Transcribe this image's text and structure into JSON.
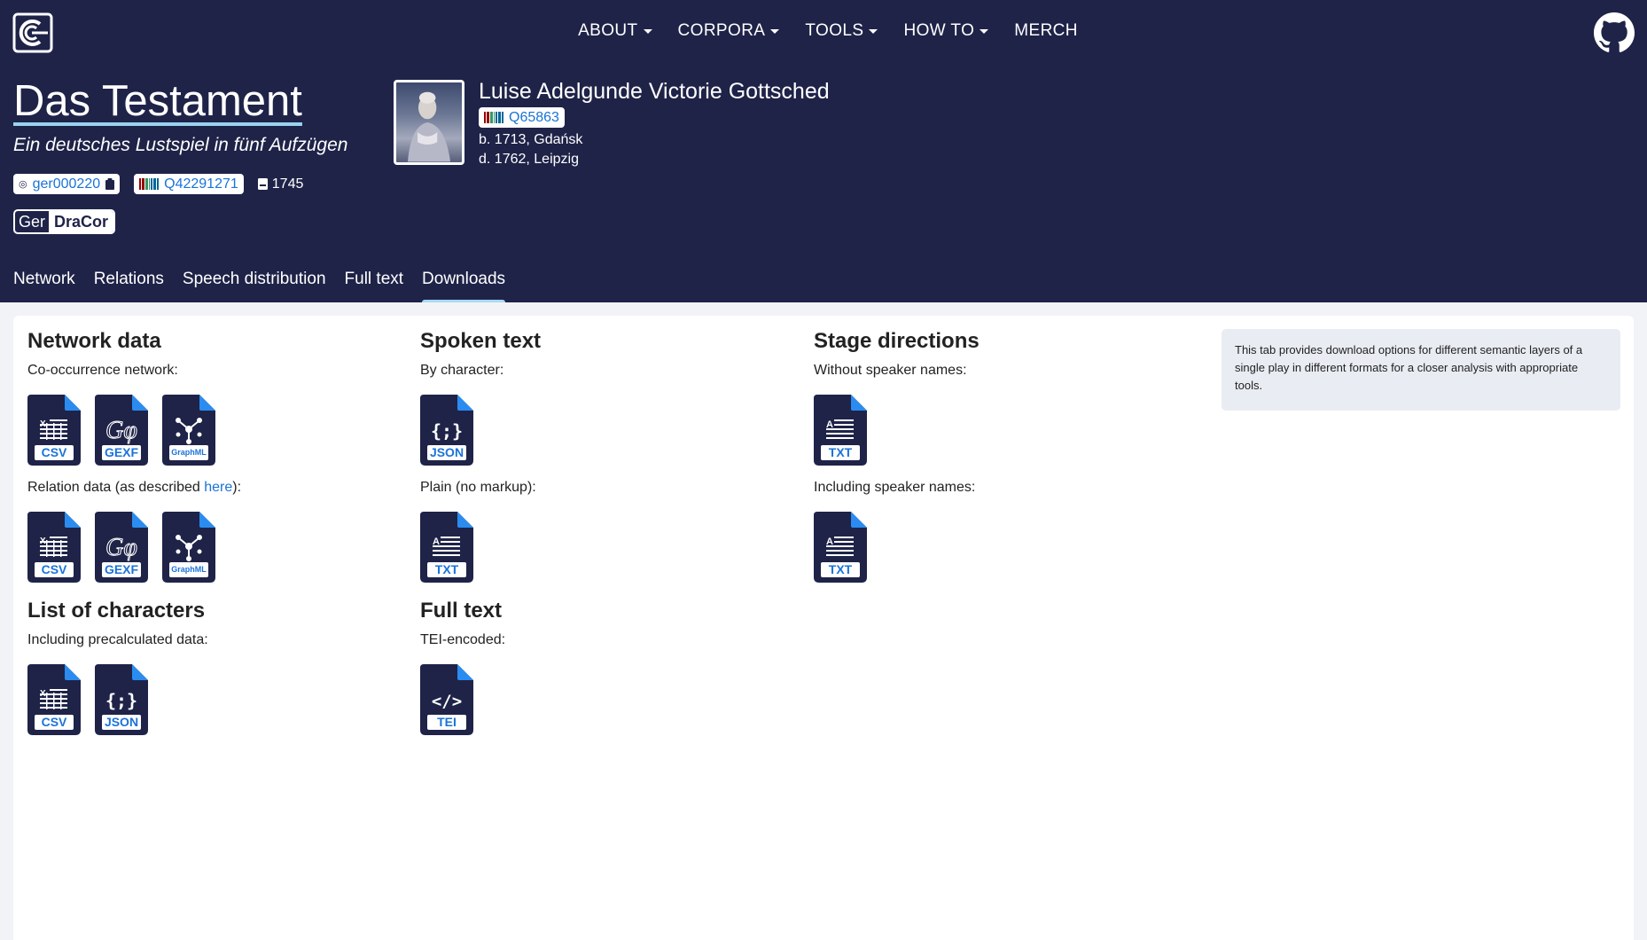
{
  "nav": {
    "items": [
      {
        "label": "ABOUT",
        "dropdown": true
      },
      {
        "label": "CORPORA",
        "dropdown": true
      },
      {
        "label": "TOOLS",
        "dropdown": true
      },
      {
        "label": "HOW TO",
        "dropdown": true
      },
      {
        "label": "MERCH",
        "dropdown": false
      }
    ]
  },
  "play": {
    "title": "Das Testament",
    "subtitle": "Ein deutsches Lustspiel in fünf Aufzügen",
    "dracor_id": "ger000220",
    "wikidata_id": "Q42291271",
    "year": "1745",
    "corpus_prefix": "Ger",
    "corpus_name": "DraCor"
  },
  "author": {
    "name": "Luise Adelgunde Victorie Gottsched",
    "wikidata_id": "Q65863",
    "born": "b. 1713, Gdańsk",
    "died": "d. 1762, Leipzig"
  },
  "tabs": [
    {
      "label": "Network",
      "active": false
    },
    {
      "label": "Relations",
      "active": false
    },
    {
      "label": "Speech distribution",
      "active": false
    },
    {
      "label": "Full text",
      "active": false
    },
    {
      "label": "Downloads",
      "active": true
    }
  ],
  "downloads": {
    "network": {
      "title": "Network data",
      "cooccurrence_label": "Co-occurrence network:",
      "relation_label_prefix": "Relation data (as described ",
      "relation_link": "here",
      "relation_label_suffix": "):",
      "formats": [
        "CSV",
        "GEXF",
        "GraphML"
      ]
    },
    "characters": {
      "title": "List of characters",
      "label": "Including precalculated data:",
      "formats": [
        "CSV",
        "JSON"
      ]
    },
    "spoken": {
      "title": "Spoken text",
      "by_character_label": "By character:",
      "by_character_format": "JSON",
      "plain_label": "Plain (no markup):",
      "plain_format": "TXT"
    },
    "fulltext": {
      "title": "Full text",
      "label": "TEI-encoded:",
      "format": "TEI"
    },
    "stage": {
      "title": "Stage directions",
      "without_label": "Without speaker names:",
      "without_format": "TXT",
      "with_label": "Including speaker names:",
      "with_format": "TXT"
    },
    "info": "This tab provides download options for different semantic layers of a single play in different formats for a closer analysis with appropriate tools."
  },
  "colors": {
    "header_bg": "#1f2348",
    "link": "#1a73d9",
    "file_icon": "#1f2348",
    "file_corner": "#2a8cf0",
    "tab_indicator": "#a8daf2"
  }
}
